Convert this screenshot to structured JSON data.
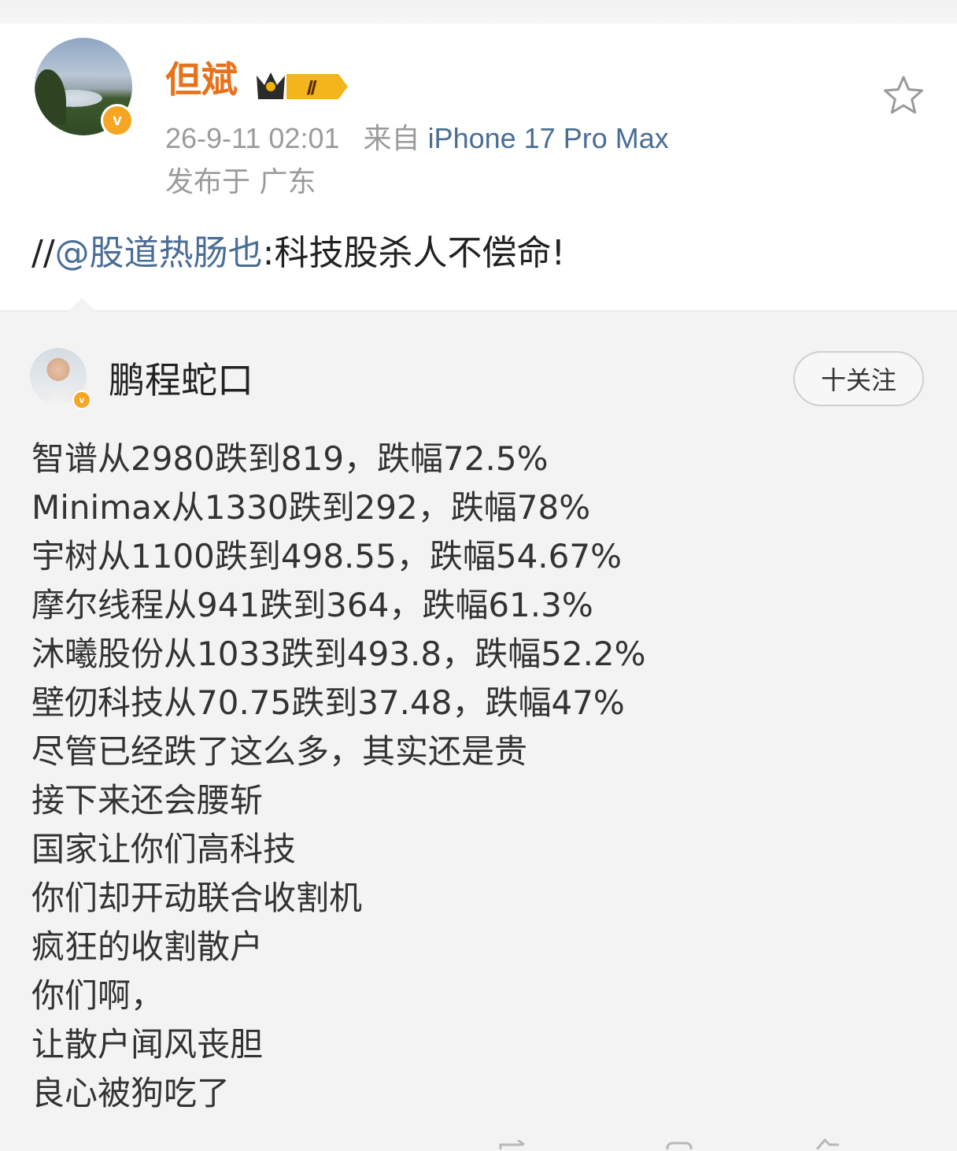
{
  "post": {
    "username": "但斌",
    "rank_badge": "Ⅱ",
    "time": "26-9-11 02:01",
    "source_prefix": "来自",
    "device": "iPhone 17 Pro Max",
    "location": "发布于 广东",
    "repost_prefix": "//",
    "mention": "@股道热肠也",
    "repost_comment": ":科技股杀人不偿命!",
    "verified_mark": "v"
  },
  "quoted": {
    "author": "鹏程蛇口",
    "verified_mark": "v",
    "follow_label": "十关注",
    "lines": [
      "智谱从2980跌到819，跌幅72.5%",
      "Minimax从1330跌到292，跌幅78%",
      "宇树从1100跌到498.55，跌幅54.67%",
      "摩尔线程从941跌到364，跌幅61.3%",
      "沐曦股份从1033跌到493.8，跌幅52.2%",
      "壁仞科技从70.75跌到37.48，跌幅47%",
      "尽管已经跌了这么多，其实还是贵",
      "接下来还会腰斩",
      "国家让你们高科技",
      "你们却开动联合收割机",
      "疯狂的收割散户",
      "你们啊，",
      "让散户闻风丧胆",
      "良心被狗吃了"
    ]
  },
  "icons": {
    "favorite": "star-outline-icon",
    "verified": "verified-v-icon",
    "rank": "crown-rank-icon"
  },
  "colors": {
    "username": "#e8721c",
    "link": "#4a6d96",
    "meta": "#9b9b9b",
    "verified": "#f5a623",
    "quoted_bg": "#f3f3f3"
  }
}
